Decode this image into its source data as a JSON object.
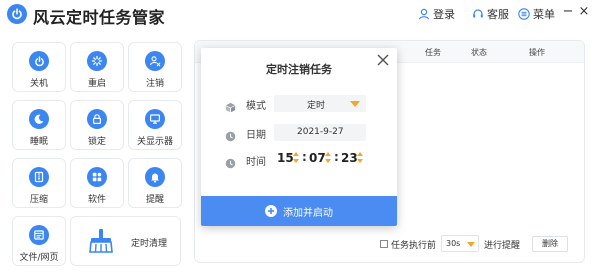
{
  "app": {
    "title": "风云定时任务管家",
    "header": {
      "login_label": "登录",
      "service_label": "客服",
      "menu_label": "菜单",
      "minimize_symbol": "−",
      "close_symbol": "×"
    }
  },
  "tools": [
    {
      "label": "关机",
      "icon": "power-icon"
    },
    {
      "label": "重启",
      "icon": "restart-icon"
    },
    {
      "label": "注销",
      "icon": "logout-icon"
    },
    {
      "label": "睡眠",
      "icon": "sleep-icon"
    },
    {
      "label": "锁定",
      "icon": "lock-icon"
    },
    {
      "label": "关显示器",
      "icon": "monitor-icon"
    },
    {
      "label": "压缩",
      "icon": "compress-icon"
    },
    {
      "label": "软件",
      "icon": "apps-icon"
    },
    {
      "label": "提醒",
      "icon": "bell-icon"
    },
    {
      "label": "文件/网页",
      "icon": "file-web-icon"
    },
    {
      "label": "定时清理",
      "icon": "broom-icon"
    }
  ],
  "task_table": {
    "columns": [
      "任务",
      "状态",
      "操作"
    ]
  },
  "footer": {
    "checkbox_label": "任务执行前",
    "lead_time_value": "30s",
    "remind_label": "进行提醒",
    "delete_label": "删除"
  },
  "modal": {
    "title": "定时注销任务",
    "mode_label": "模式",
    "mode_value": "定时",
    "date_label": "日期",
    "date_value": "2021-9-27",
    "time_label": "时间",
    "time_hour": "15",
    "time_minute": "07",
    "time_second": "23",
    "time_separator": ":",
    "action_label": "添加并启动"
  },
  "colors": {
    "accent": "#3b86f0",
    "action_bar": "#4a8cf1",
    "spinner": "#f5a623"
  }
}
